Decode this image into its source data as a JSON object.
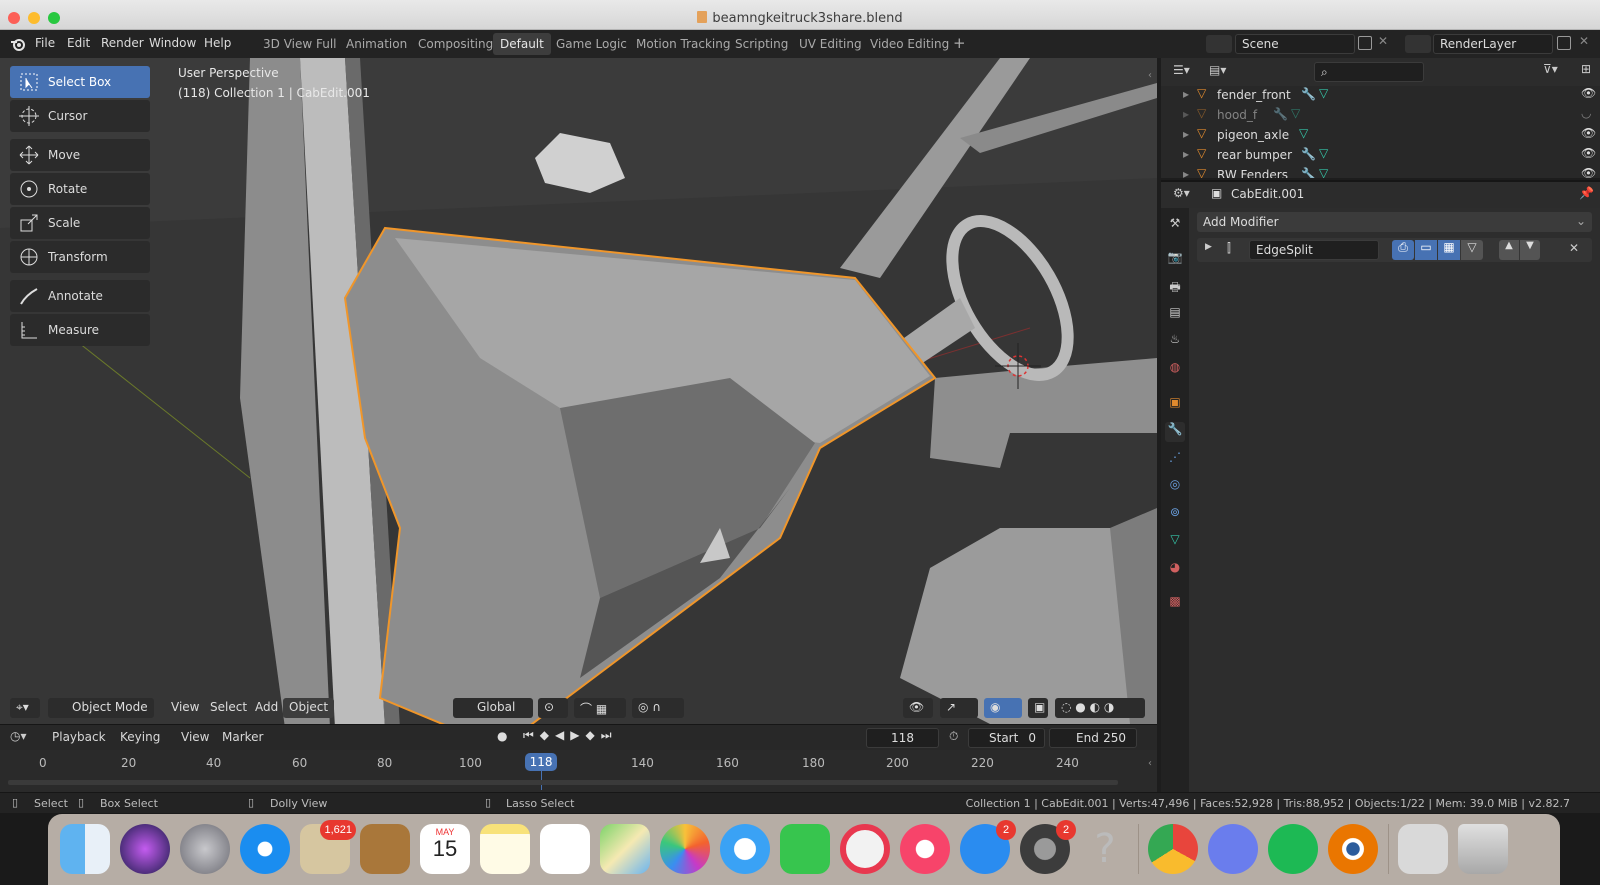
{
  "window": {
    "title": "beamngkeitruck3share.blend"
  },
  "menu": [
    "File",
    "Edit",
    "Render",
    "Window",
    "Help"
  ],
  "workspaces": [
    "3D View Full",
    "Animation",
    "Compositing",
    "Default",
    "Game Logic",
    "Motion Tracking",
    "Scripting",
    "UV Editing",
    "Video Editing"
  ],
  "active_workspace": "Default",
  "scene": {
    "name": "Scene",
    "render_layer": "RenderLayer"
  },
  "viewport": {
    "perspective": "User Perspective",
    "info": "(118) Collection 1 | CabEdit.001",
    "mode": "Object Mode",
    "header_menus": [
      "View",
      "Select",
      "Add",
      "Object"
    ],
    "transform_orientation": "Global"
  },
  "tools": [
    {
      "label": "Select Box",
      "icon": "select-box-icon",
      "active": true
    },
    {
      "label": "Cursor",
      "icon": "cursor-icon",
      "active": false
    },
    {
      "label": "Move",
      "icon": "move-icon",
      "active": false
    },
    {
      "label": "Rotate",
      "icon": "rotate-icon",
      "active": false
    },
    {
      "label": "Scale",
      "icon": "scale-icon",
      "active": false
    },
    {
      "label": "Transform",
      "icon": "transform-icon",
      "active": false
    },
    {
      "label": "Annotate",
      "icon": "annotate-icon",
      "active": false
    },
    {
      "label": "Measure",
      "icon": "measure-icon",
      "active": false
    }
  ],
  "outliner": {
    "items": [
      {
        "name": "fender_front",
        "visible": true
      },
      {
        "name": "hood_f",
        "visible": false
      },
      {
        "name": "pigeon_axle",
        "visible": true
      },
      {
        "name": "rear bumper",
        "visible": true
      },
      {
        "name": "RW Fenders",
        "visible": true
      }
    ]
  },
  "properties": {
    "object_name": "CabEdit.001",
    "add_modifier": "Add Modifier",
    "modifier_name": "EdgeSplit"
  },
  "timeline": {
    "menus": [
      "Playback",
      "Keying",
      "View",
      "Marker"
    ],
    "current_frame": "118",
    "start_label": "Start",
    "start": "0",
    "end_label": "End",
    "end": "250",
    "ticks": [
      "0",
      "20",
      "40",
      "60",
      "80",
      "100",
      "140",
      "160",
      "180",
      "200",
      "220",
      "240"
    ],
    "playhead_label": "118",
    "playhead_frame": 118
  },
  "status": {
    "select": "Select",
    "box_select": "Box Select",
    "dolly": "Dolly View",
    "lasso": "Lasso Select",
    "stats": "Collection 1 | CabEdit.001 | Verts:47,496 | Faces:52,928 | Tris:88,952 | Objects:1/22 | Mem: 39.0 MiB | v2.82.7"
  },
  "dock": {
    "mail_badge": "1,621",
    "calendar_month": "MAY",
    "calendar_day": "15",
    "appstore_badge": "2",
    "prefs_badge": "2"
  },
  "colors": {
    "accent": "#4772b3",
    "selection_outline": "#f0962a",
    "viewport_bg": "#3a3a3a"
  }
}
